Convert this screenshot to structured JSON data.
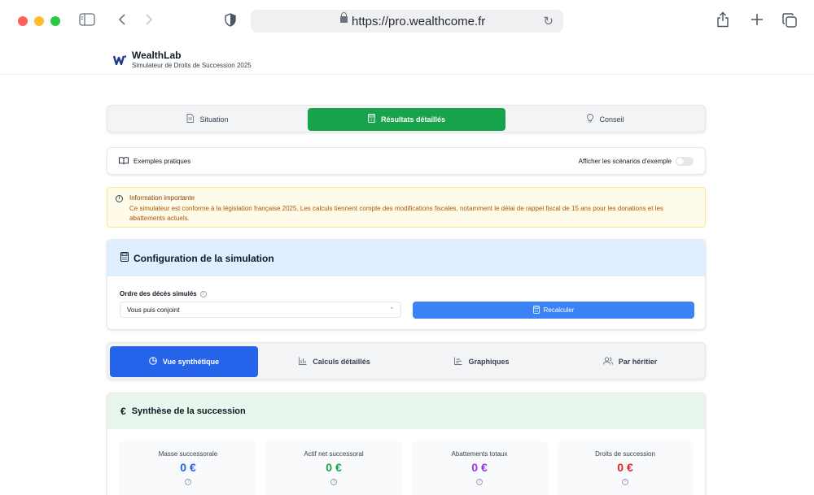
{
  "browser": {
    "url": "https://pro.wealthcome.fr"
  },
  "app": {
    "brand": "WealthLab",
    "subtitle": "Simulateur de Droits de Succession 2025"
  },
  "main_tabs": [
    {
      "label": "Situation",
      "icon": "document-icon",
      "active": false
    },
    {
      "label": "Résultats détaillés",
      "icon": "calculator-icon",
      "active": true
    },
    {
      "label": "Conseil",
      "icon": "lightbulb-icon",
      "active": false
    }
  ],
  "examples": {
    "label": "Exemples pratiques",
    "toggle_label": "Afficher les scénarios d'exemple",
    "toggle_on": false
  },
  "info": {
    "title": "Information importante",
    "message": "Ce simulateur est conforme à la législation française 2025. Les calculs tiennent compte des modifications fiscales, notamment le délai de rappel fiscal de 15 ans pour les donations et les abattements actuels."
  },
  "config": {
    "title": "Configuration de la simulation",
    "order_label": "Ordre des décès simulés",
    "order_value": "Vous puis conjoint",
    "recalc_label": "Recalculer"
  },
  "view_tabs": [
    {
      "label": "Vue synthétique",
      "icon": "pie-chart-icon",
      "active": true
    },
    {
      "label": "Calculs détaillés",
      "icon": "bar-chart-icon",
      "active": false
    },
    {
      "label": "Graphiques",
      "icon": "chart-icon",
      "active": false
    },
    {
      "label": "Par héritier",
      "icon": "users-icon",
      "active": false
    }
  ],
  "synthesis": {
    "title": "Synthèse de la succession",
    "stats": [
      {
        "label": "Masse successorale",
        "value": "0 €",
        "color": "#2563eb"
      },
      {
        "label": "Actif net successoral",
        "value": "0 €",
        "color": "#16a34a"
      },
      {
        "label": "Abattements totaux",
        "value": "0 €",
        "color": "#9333ea"
      },
      {
        "label": "Droits de succession",
        "value": "0 €",
        "color": "#dc2626"
      }
    ]
  },
  "colors": {
    "accent_green": "#16a34a",
    "accent_blue": "#2563eb",
    "button_blue": "#3b82f6"
  }
}
